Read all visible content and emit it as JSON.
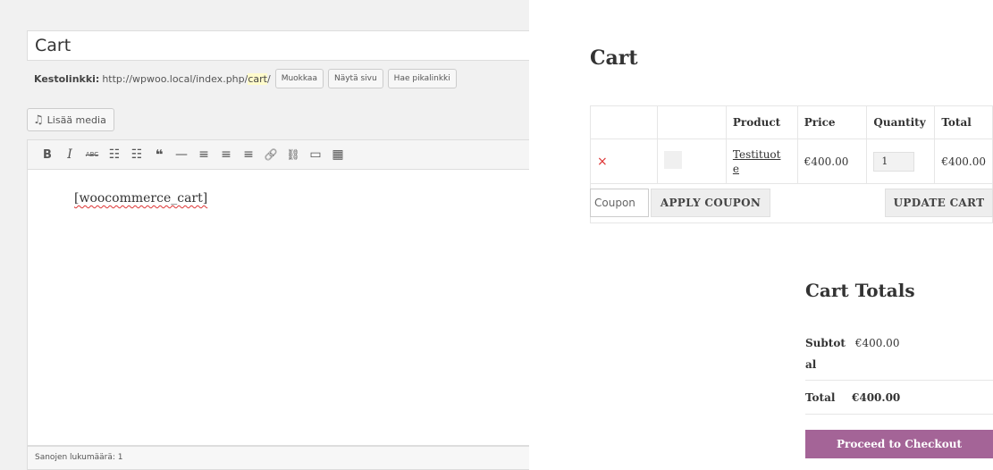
{
  "editor": {
    "title_value": "Cart",
    "permalink": {
      "label": "Kestolinkki:",
      "url_prefix": "http://wpwoo.local/index.php/",
      "slug": "cart",
      "url_suffix": "/",
      "edit_button": "Muokkaa",
      "view_button": "Näytä sivu",
      "shortlink_button": "Hae pikalinkki"
    },
    "add_media_label": "Lisää media",
    "toolbar_icons": [
      "bold-icon",
      "italic-icon",
      "strikethrough-icon",
      "bullet-list-icon",
      "numbered-list-icon",
      "blockquote-icon",
      "horizontal-line-icon",
      "align-left-icon",
      "align-center-icon",
      "align-right-icon",
      "link-icon",
      "unlink-icon",
      "read-more-icon",
      "toolbar-toggle-icon"
    ],
    "toolbar_glyphs": [
      "B",
      "I",
      "ABC",
      "☷",
      "☷",
      "❝",
      "—",
      "≡",
      "≡",
      "≡",
      "🔗",
      "⛓",
      "▭",
      "▦"
    ],
    "content": "[woocommerce_cart]",
    "word_count": "Sanojen lukumäärä: 1"
  },
  "cart": {
    "heading": "Cart",
    "columns": [
      "",
      "",
      "Product",
      "Price",
      "Quantity",
      "Total"
    ],
    "row": {
      "remove": "×",
      "product": "Testituote",
      "price": "€400.00",
      "quantity": "1",
      "total": "€400.00"
    },
    "coupon_placeholder": "Coupon",
    "apply_coupon": "APPLY COUPON",
    "update_cart": "UPDATE CART",
    "totals_heading": "Cart Totals",
    "subtotal_label": "Subtotal",
    "subtotal_value": "€400.00",
    "total_label": "Total",
    "total_value": "€400.00",
    "checkout_button": "Proceed to Checkout",
    "accent_color": "#a46497",
    "remove_color": "#dd3333"
  }
}
